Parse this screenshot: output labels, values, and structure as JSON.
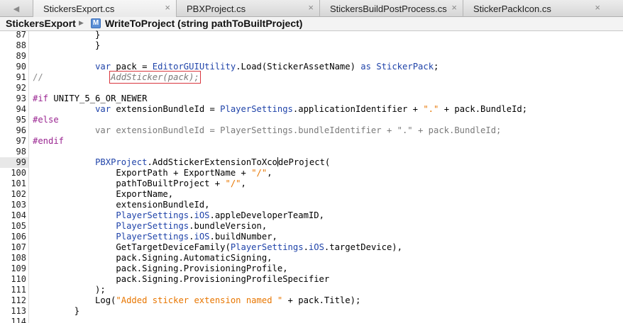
{
  "tabs": [
    {
      "label": "StickersExport.cs",
      "active": true
    },
    {
      "label": "PBXProject.cs",
      "active": false
    },
    {
      "label": "StickersBuildPostProcess.cs",
      "active": false
    },
    {
      "label": "StickerPackIcon.cs",
      "active": false
    }
  ],
  "tab_close_glyph": "×",
  "jumpbar": {
    "file": "StickersExport",
    "method_badge": "M",
    "method": "WriteToProject (string pathToBuiltProject)"
  },
  "editor": {
    "current_line": 99,
    "lines": [
      {
        "n": "87",
        "t": "            }"
      },
      {
        "n": "88",
        "t": "            }"
      },
      {
        "n": "89",
        "t": ""
      },
      {
        "n": "90",
        "t": "            var pack = EditorGUIUtility.Load(StickerAssetName) as StickerPack;"
      },
      {
        "n": "91",
        "t": "//             AddSticker(pack);"
      },
      {
        "n": "92",
        "t": ""
      },
      {
        "n": "93",
        "t": "#if UNITY_5_6_OR_NEWER"
      },
      {
        "n": "94",
        "t": "            var extensionBundleId = PlayerSettings.applicationIdentifier + \".\" + pack.BundleId;"
      },
      {
        "n": "95",
        "t": "#else"
      },
      {
        "n": "96",
        "t": "            var extensionBundleId = PlayerSettings.bundleIdentifier + \".\" + pack.BundleId;"
      },
      {
        "n": "97",
        "t": "#endif"
      },
      {
        "n": "98",
        "t": ""
      },
      {
        "n": "99",
        "t": "            PBXProject.AddStickerExtensionToXcodeProject("
      },
      {
        "n": "100",
        "t": "                ExportPath + ExportName + \"/\","
      },
      {
        "n": "101",
        "t": "                pathToBuiltProject + \"/\","
      },
      {
        "n": "102",
        "t": "                ExportName,"
      },
      {
        "n": "103",
        "t": "                extensionBundleId,"
      },
      {
        "n": "104",
        "t": "                PlayerSettings.iOS.appleDeveloperTeamID,"
      },
      {
        "n": "105",
        "t": "                PlayerSettings.bundleVersion,"
      },
      {
        "n": "106",
        "t": "                PlayerSettings.iOS.buildNumber,"
      },
      {
        "n": "107",
        "t": "                GetTargetDeviceFamily(PlayerSettings.iOS.targetDevice),"
      },
      {
        "n": "108",
        "t": "                pack.Signing.AutomaticSigning,"
      },
      {
        "n": "109",
        "t": "                pack.Signing.ProvisioningProfile,"
      },
      {
        "n": "110",
        "t": "                pack.Signing.ProvisioningProfileSpecifier"
      },
      {
        "n": "111",
        "t": "            );"
      },
      {
        "n": "112",
        "t": "            Log(\"Added sticker extension named \" + pack.Title);"
      },
      {
        "n": "113",
        "t": "        }"
      },
      {
        "n": "114",
        "t": ""
      }
    ]
  },
  "colors": {
    "keyword": "#1f43a9",
    "string": "#e87600",
    "preprocessor": "#9a2591",
    "comment": "#8a8a8a",
    "highlight_box": "#d9363e"
  }
}
